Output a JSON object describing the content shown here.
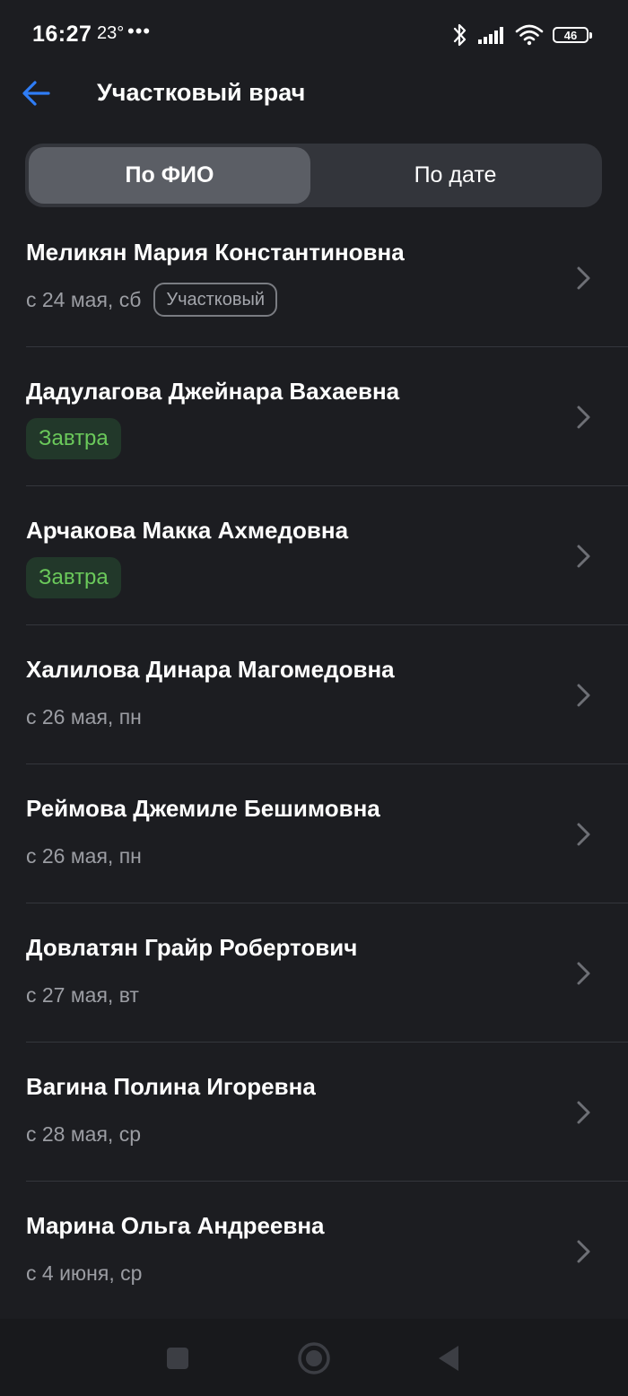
{
  "status_bar": {
    "time": "16:27",
    "temperature": "23°",
    "more": "•••",
    "battery": "46",
    "icons": [
      "bluetooth-icon",
      "signal-icon",
      "wifi-icon",
      "battery-icon"
    ]
  },
  "header": {
    "title": "Участковый врач",
    "back_icon": "arrow-left-icon",
    "accent_color": "#2f7df6"
  },
  "tabs": [
    {
      "label": "По ФИО",
      "active": true
    },
    {
      "label": "По дате",
      "active": false
    }
  ],
  "doctors": [
    {
      "name": "Меликян Мария Константиновна",
      "date": "с 24 мая, сб",
      "tag": "Участковый",
      "tag_style": "outline"
    },
    {
      "name": "Дадулагова Джейнара Вахаевна",
      "date": "",
      "tag": "Завтра",
      "tag_style": "green"
    },
    {
      "name": "Арчакова Макка Ахмедовна",
      "date": "",
      "tag": "Завтра",
      "tag_style": "green"
    },
    {
      "name": "Халилова Динара Магомедовна",
      "date": "с 26 мая, пн",
      "tag": "",
      "tag_style": ""
    },
    {
      "name": "Реймова Джемиле Бешимовна",
      "date": "с 26 мая, пн",
      "tag": "",
      "tag_style": ""
    },
    {
      "name": "Довлатян Грайр Робертович",
      "date": "с 27 мая, вт",
      "tag": "",
      "tag_style": ""
    },
    {
      "name": "Вагина Полина Игоревна",
      "date": "с 28 мая, ср",
      "tag": "",
      "tag_style": ""
    },
    {
      "name": "Марина Ольга Андреевна",
      "date": "с 4 июня, ср",
      "tag": "",
      "tag_style": ""
    }
  ],
  "nav_bar": {
    "buttons": [
      "recent-apps-icon",
      "home-icon",
      "back-triangle-icon"
    ]
  },
  "colors": {
    "background": "#1c1d21",
    "green_tag_text": "#6bc95b",
    "green_tag_bg": "#22382a"
  }
}
